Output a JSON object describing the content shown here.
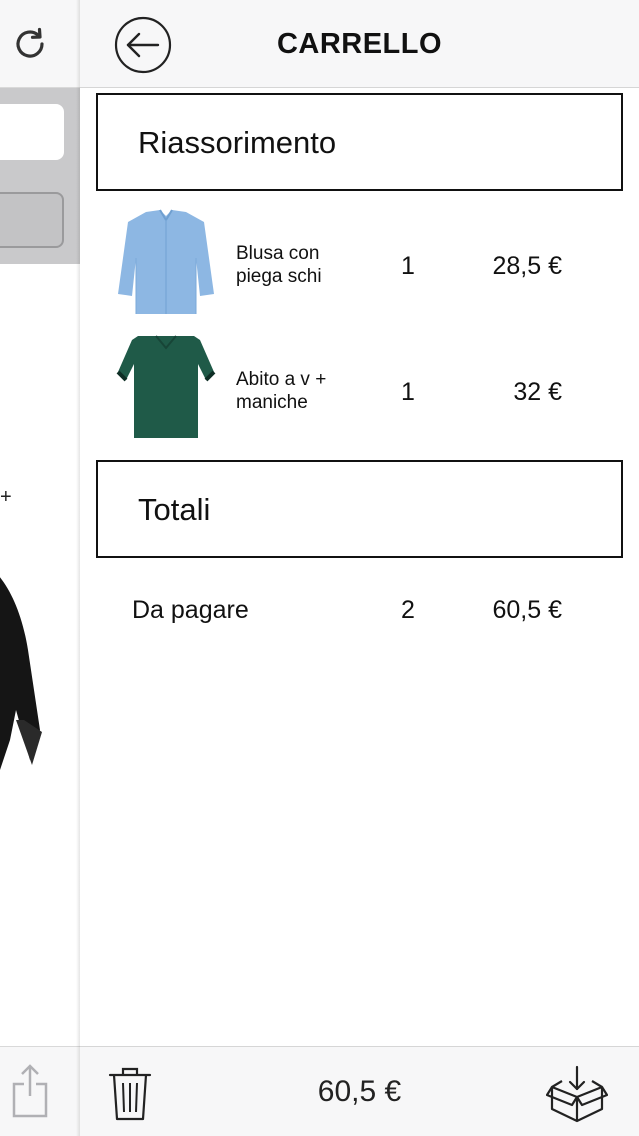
{
  "header": {
    "title": "CARRELLO",
    "back_icon": "arrow-left-circle-icon"
  },
  "background_page": {
    "refresh_icon": "refresh-icon",
    "partial_text": "+",
    "share_icon": "share-icon"
  },
  "sections": {
    "items_title": "Riassorimento",
    "totals_title": "Totali"
  },
  "cart_items": [
    {
      "name": "Blusa con piega schi",
      "quantity": "1",
      "price": "28,5 €",
      "image": "blue-blouse-image",
      "color": "#8db7e3"
    },
    {
      "name": "Abito a v + maniche",
      "quantity": "1",
      "price": "32 €",
      "image": "green-dress-image",
      "color": "#1f5a48"
    }
  ],
  "totals": {
    "label": "Da pagare",
    "quantity": "2",
    "price": "60,5 €"
  },
  "footer": {
    "trash_icon": "trash-icon",
    "total": "60,5 €",
    "checkout_icon": "box-download-icon"
  },
  "colors": {
    "bar_background": "#f7f7f8",
    "text": "#111111",
    "border": "#111111"
  }
}
